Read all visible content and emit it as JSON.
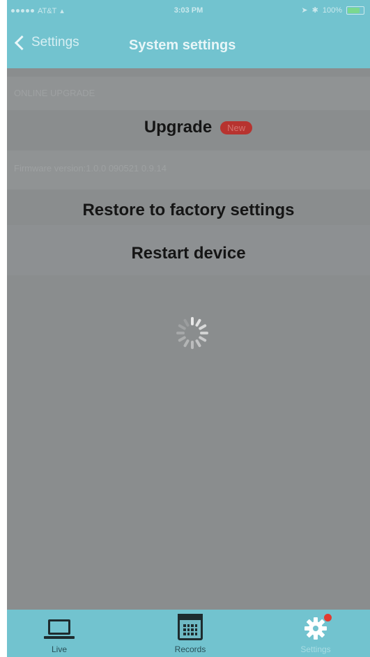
{
  "status_bar": {
    "carrier": "AT&T",
    "time": "3:03 PM",
    "battery": "100%"
  },
  "header": {
    "back_label": "Settings",
    "title": "System settings"
  },
  "background_rows": {
    "row1": "ONLINE UPGRADE",
    "row2": "Firmware version:1.0.0 090521 0.9.14"
  },
  "menu": {
    "upgrade_label": "Upgrade",
    "new_badge": "New",
    "restore_label": "Restore to factory settings",
    "restart_label": "Restart device"
  },
  "tabs": [
    {
      "label": "Live",
      "icon": "laptop-icon"
    },
    {
      "label": "Records",
      "icon": "calendar-icon"
    },
    {
      "label": "Settings",
      "icon": "gear-icon"
    }
  ],
  "colors": {
    "accent": "#72c3cf",
    "overlay": "#8a8d8e",
    "badge": "#b7332f",
    "notification_dot": "#e03b31"
  }
}
